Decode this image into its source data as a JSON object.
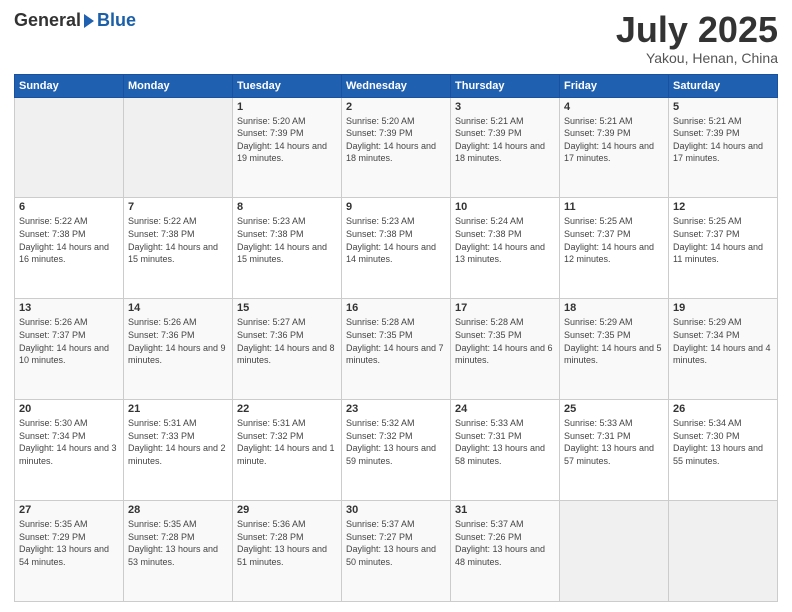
{
  "logo": {
    "general": "General",
    "blue": "Blue"
  },
  "header": {
    "month": "July 2025",
    "location": "Yakou, Henan, China"
  },
  "days_of_week": [
    "Sunday",
    "Monday",
    "Tuesday",
    "Wednesday",
    "Thursday",
    "Friday",
    "Saturday"
  ],
  "weeks": [
    [
      {
        "day": "",
        "sunrise": "",
        "sunset": "",
        "daylight": ""
      },
      {
        "day": "",
        "sunrise": "",
        "sunset": "",
        "daylight": ""
      },
      {
        "day": "1",
        "sunrise": "Sunrise: 5:20 AM",
        "sunset": "Sunset: 7:39 PM",
        "daylight": "Daylight: 14 hours and 19 minutes."
      },
      {
        "day": "2",
        "sunrise": "Sunrise: 5:20 AM",
        "sunset": "Sunset: 7:39 PM",
        "daylight": "Daylight: 14 hours and 18 minutes."
      },
      {
        "day": "3",
        "sunrise": "Sunrise: 5:21 AM",
        "sunset": "Sunset: 7:39 PM",
        "daylight": "Daylight: 14 hours and 18 minutes."
      },
      {
        "day": "4",
        "sunrise": "Sunrise: 5:21 AM",
        "sunset": "Sunset: 7:39 PM",
        "daylight": "Daylight: 14 hours and 17 minutes."
      },
      {
        "day": "5",
        "sunrise": "Sunrise: 5:21 AM",
        "sunset": "Sunset: 7:39 PM",
        "daylight": "Daylight: 14 hours and 17 minutes."
      }
    ],
    [
      {
        "day": "6",
        "sunrise": "Sunrise: 5:22 AM",
        "sunset": "Sunset: 7:38 PM",
        "daylight": "Daylight: 14 hours and 16 minutes."
      },
      {
        "day": "7",
        "sunrise": "Sunrise: 5:22 AM",
        "sunset": "Sunset: 7:38 PM",
        "daylight": "Daylight: 14 hours and 15 minutes."
      },
      {
        "day": "8",
        "sunrise": "Sunrise: 5:23 AM",
        "sunset": "Sunset: 7:38 PM",
        "daylight": "Daylight: 14 hours and 15 minutes."
      },
      {
        "day": "9",
        "sunrise": "Sunrise: 5:23 AM",
        "sunset": "Sunset: 7:38 PM",
        "daylight": "Daylight: 14 hours and 14 minutes."
      },
      {
        "day": "10",
        "sunrise": "Sunrise: 5:24 AM",
        "sunset": "Sunset: 7:38 PM",
        "daylight": "Daylight: 14 hours and 13 minutes."
      },
      {
        "day": "11",
        "sunrise": "Sunrise: 5:25 AM",
        "sunset": "Sunset: 7:37 PM",
        "daylight": "Daylight: 14 hours and 12 minutes."
      },
      {
        "day": "12",
        "sunrise": "Sunrise: 5:25 AM",
        "sunset": "Sunset: 7:37 PM",
        "daylight": "Daylight: 14 hours and 11 minutes."
      }
    ],
    [
      {
        "day": "13",
        "sunrise": "Sunrise: 5:26 AM",
        "sunset": "Sunset: 7:37 PM",
        "daylight": "Daylight: 14 hours and 10 minutes."
      },
      {
        "day": "14",
        "sunrise": "Sunrise: 5:26 AM",
        "sunset": "Sunset: 7:36 PM",
        "daylight": "Daylight: 14 hours and 9 minutes."
      },
      {
        "day": "15",
        "sunrise": "Sunrise: 5:27 AM",
        "sunset": "Sunset: 7:36 PM",
        "daylight": "Daylight: 14 hours and 8 minutes."
      },
      {
        "day": "16",
        "sunrise": "Sunrise: 5:28 AM",
        "sunset": "Sunset: 7:35 PM",
        "daylight": "Daylight: 14 hours and 7 minutes."
      },
      {
        "day": "17",
        "sunrise": "Sunrise: 5:28 AM",
        "sunset": "Sunset: 7:35 PM",
        "daylight": "Daylight: 14 hours and 6 minutes."
      },
      {
        "day": "18",
        "sunrise": "Sunrise: 5:29 AM",
        "sunset": "Sunset: 7:35 PM",
        "daylight": "Daylight: 14 hours and 5 minutes."
      },
      {
        "day": "19",
        "sunrise": "Sunrise: 5:29 AM",
        "sunset": "Sunset: 7:34 PM",
        "daylight": "Daylight: 14 hours and 4 minutes."
      }
    ],
    [
      {
        "day": "20",
        "sunrise": "Sunrise: 5:30 AM",
        "sunset": "Sunset: 7:34 PM",
        "daylight": "Daylight: 14 hours and 3 minutes."
      },
      {
        "day": "21",
        "sunrise": "Sunrise: 5:31 AM",
        "sunset": "Sunset: 7:33 PM",
        "daylight": "Daylight: 14 hours and 2 minutes."
      },
      {
        "day": "22",
        "sunrise": "Sunrise: 5:31 AM",
        "sunset": "Sunset: 7:32 PM",
        "daylight": "Daylight: 14 hours and 1 minute."
      },
      {
        "day": "23",
        "sunrise": "Sunrise: 5:32 AM",
        "sunset": "Sunset: 7:32 PM",
        "daylight": "Daylight: 13 hours and 59 minutes."
      },
      {
        "day": "24",
        "sunrise": "Sunrise: 5:33 AM",
        "sunset": "Sunset: 7:31 PM",
        "daylight": "Daylight: 13 hours and 58 minutes."
      },
      {
        "day": "25",
        "sunrise": "Sunrise: 5:33 AM",
        "sunset": "Sunset: 7:31 PM",
        "daylight": "Daylight: 13 hours and 57 minutes."
      },
      {
        "day": "26",
        "sunrise": "Sunrise: 5:34 AM",
        "sunset": "Sunset: 7:30 PM",
        "daylight": "Daylight: 13 hours and 55 minutes."
      }
    ],
    [
      {
        "day": "27",
        "sunrise": "Sunrise: 5:35 AM",
        "sunset": "Sunset: 7:29 PM",
        "daylight": "Daylight: 13 hours and 54 minutes."
      },
      {
        "day": "28",
        "sunrise": "Sunrise: 5:35 AM",
        "sunset": "Sunset: 7:28 PM",
        "daylight": "Daylight: 13 hours and 53 minutes."
      },
      {
        "day": "29",
        "sunrise": "Sunrise: 5:36 AM",
        "sunset": "Sunset: 7:28 PM",
        "daylight": "Daylight: 13 hours and 51 minutes."
      },
      {
        "day": "30",
        "sunrise": "Sunrise: 5:37 AM",
        "sunset": "Sunset: 7:27 PM",
        "daylight": "Daylight: 13 hours and 50 minutes."
      },
      {
        "day": "31",
        "sunrise": "Sunrise: 5:37 AM",
        "sunset": "Sunset: 7:26 PM",
        "daylight": "Daylight: 13 hours and 48 minutes."
      },
      {
        "day": "",
        "sunrise": "",
        "sunset": "",
        "daylight": ""
      },
      {
        "day": "",
        "sunrise": "",
        "sunset": "",
        "daylight": ""
      }
    ]
  ]
}
